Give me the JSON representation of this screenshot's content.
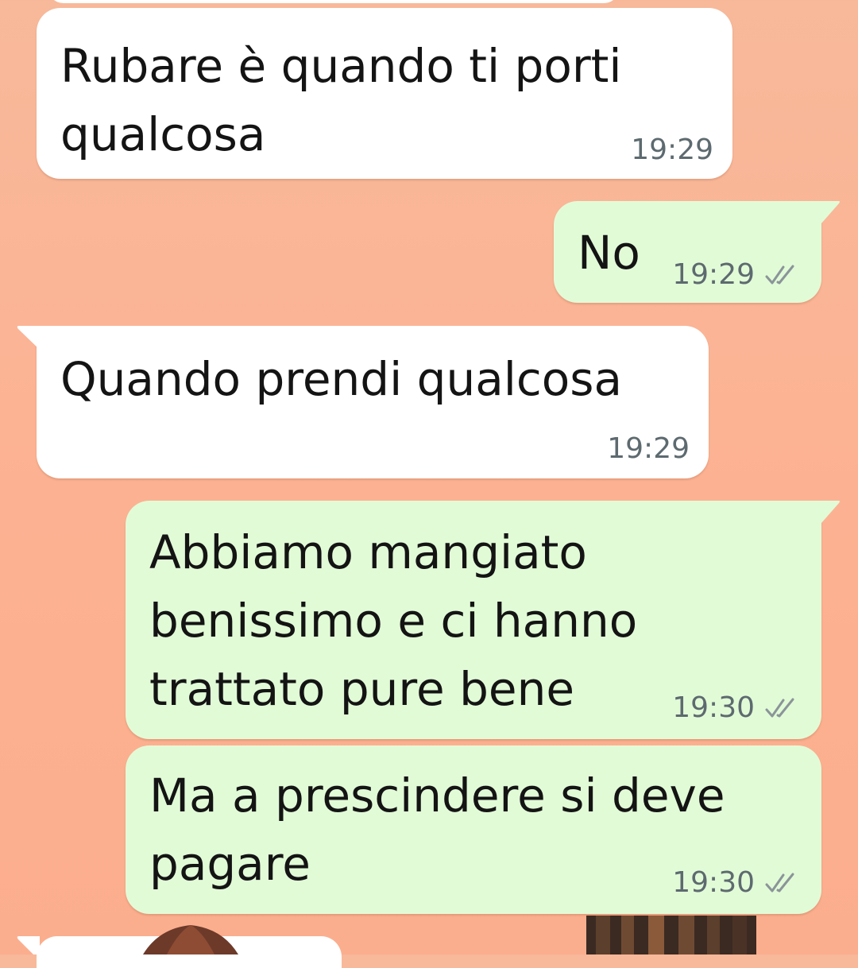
{
  "chat": {
    "messages": [
      {
        "direction": "in",
        "text": "Rubare è quando ti porti\nqualcosa",
        "time": "19:29"
      },
      {
        "direction": "out",
        "text": "No",
        "time": "19:29",
        "status_icon": "double-check-icon"
      },
      {
        "direction": "in",
        "text": "Quando prendi qualcosa",
        "time": "19:29"
      },
      {
        "direction": "out",
        "text": "Abbiamo mangiato\nbenissimo e ci hanno\ntrattato pure bene",
        "time": "19:30",
        "status_icon": "double-check-icon"
      },
      {
        "direction": "out",
        "text": "Ma a prescindere si deve\npagare",
        "time": "19:30",
        "status_icon": "double-check-icon"
      }
    ]
  },
  "colors": {
    "wallpaper": "#fbb495",
    "incoming_bubble": "#ffffff",
    "outgoing_bubble": "#e2fbd7",
    "text": "#141414",
    "meta": "#5d6a6f"
  }
}
